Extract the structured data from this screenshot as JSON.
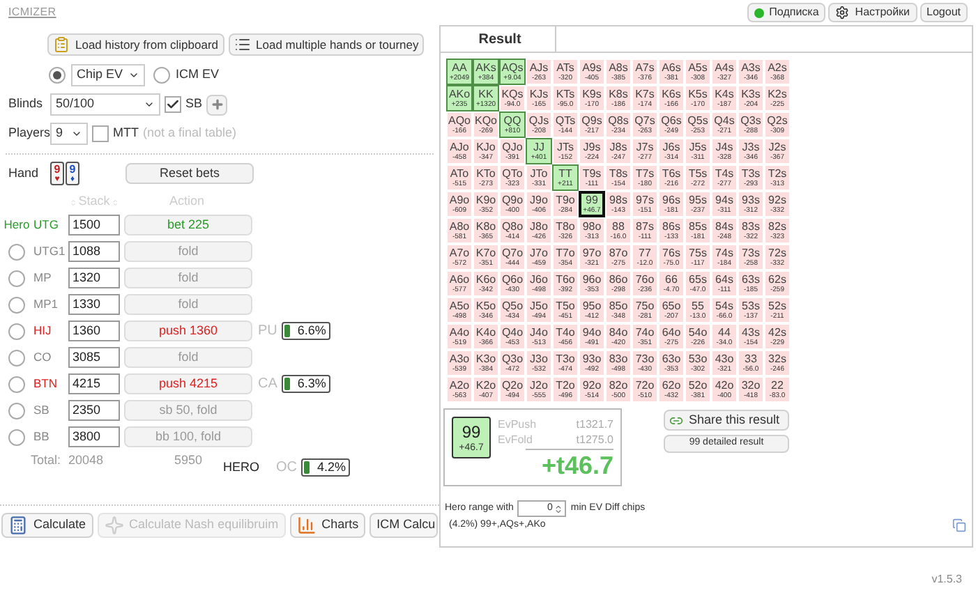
{
  "app": {
    "title": "ICMIZER",
    "version": "v1.5.3"
  },
  "top_buttons": [
    {
      "label": "Подписка",
      "kind": "dot"
    },
    {
      "label": "Настройки",
      "kind": "gear"
    },
    {
      "label": "Logout",
      "kind": "plain"
    }
  ],
  "load_buttons": [
    {
      "label": "Load history from clipboard",
      "kind": "clipboard"
    },
    {
      "label": "Load multiple hands or tourney",
      "kind": "list"
    }
  ],
  "ev_modes": [
    {
      "label": "Chip EV",
      "selected": true,
      "kind": "select"
    },
    {
      "label": "ICM EV",
      "selected": false,
      "kind": "plain"
    }
  ],
  "blinds": {
    "label": "Blinds",
    "value": "50/100",
    "sb_label": "SB",
    "sb_checked": true
  },
  "players_setting": {
    "label": "Players",
    "value": "9",
    "mtt_label": "MTT",
    "mtt_checked": false,
    "mtt_hint": "(not a final table)"
  },
  "hand": {
    "label": "Hand",
    "cards": [
      {
        "rank": "9",
        "suit": "♥",
        "color": "#c02020"
      },
      {
        "rank": "9",
        "suit": "♦",
        "color": "#2050c0"
      }
    ],
    "reset_label": "Reset bets"
  },
  "table_headers": {
    "stack": "Stack",
    "action": "Action"
  },
  "hero_label": "Hero",
  "players": [
    {
      "position": "UTG",
      "selected": true,
      "kind": "hero",
      "stack": "1500",
      "action": "bet 225"
    },
    {
      "position": "UTG1",
      "selected": false,
      "kind": "fold",
      "stack": "1088",
      "action": "fold"
    },
    {
      "position": "MP",
      "selected": false,
      "kind": "fold",
      "stack": "1320",
      "action": "fold"
    },
    {
      "position": "MP1",
      "selected": false,
      "kind": "fold",
      "stack": "1330",
      "action": "fold"
    },
    {
      "position": "HIJ",
      "selected": false,
      "kind": "push",
      "stack": "1360",
      "action": "push 1360",
      "range": {
        "tag": "PU",
        "percent": "6.6%"
      }
    },
    {
      "position": "CO",
      "selected": false,
      "kind": "fold",
      "stack": "3085",
      "action": "fold"
    },
    {
      "position": "BTN",
      "selected": false,
      "kind": "push",
      "stack": "4215",
      "action": "push 4215",
      "range": {
        "tag": "CA",
        "percent": "6.3%"
      }
    },
    {
      "position": "SB",
      "selected": false,
      "kind": "fold",
      "stack": "2350",
      "action": "sb 50, fold"
    },
    {
      "position": "BB",
      "selected": false,
      "kind": "fold",
      "stack": "3800",
      "action": "bb 100, fold"
    }
  ],
  "totals": {
    "label": "Total:",
    "stack": "20048",
    "pot": "5950"
  },
  "hero_range": {
    "label": "HERO",
    "tag": "OC",
    "percent": "4.2%"
  },
  "bottom_buttons": [
    {
      "label": "Calculate",
      "kind": "calculator",
      "disabled": false
    },
    {
      "label": "Calculate Nash equilibruim",
      "kind": "spark",
      "disabled": true
    },
    {
      "label": "Charts",
      "kind": "chart",
      "disabled": false
    },
    {
      "label": "ICM Calcu",
      "kind": "plain",
      "disabled": false
    }
  ],
  "result": {
    "tab": "Result",
    "grid": [
      [
        {
          "hand": "AA",
          "ev": "+2049",
          "in_range": true,
          "selected": false
        },
        {
          "hand": "AKs",
          "ev": "+384",
          "in_range": true,
          "selected": false
        },
        {
          "hand": "AQs",
          "ev": "+9.04",
          "in_range": true,
          "selected": false
        },
        {
          "hand": "AJs",
          "ev": "-263",
          "in_range": false,
          "selected": false
        },
        {
          "hand": "ATs",
          "ev": "-320",
          "in_range": false,
          "selected": false
        },
        {
          "hand": "A9s",
          "ev": "-405",
          "in_range": false,
          "selected": false
        },
        {
          "hand": "A8s",
          "ev": "-385",
          "in_range": false,
          "selected": false
        },
        {
          "hand": "A7s",
          "ev": "-376",
          "in_range": false,
          "selected": false
        },
        {
          "hand": "A6s",
          "ev": "-381",
          "in_range": false,
          "selected": false
        },
        {
          "hand": "A5s",
          "ev": "-308",
          "in_range": false,
          "selected": false
        },
        {
          "hand": "A4s",
          "ev": "-327",
          "in_range": false,
          "selected": false
        },
        {
          "hand": "A3s",
          "ev": "-346",
          "in_range": false,
          "selected": false
        },
        {
          "hand": "A2s",
          "ev": "-368",
          "in_range": false,
          "selected": false
        }
      ],
      [
        {
          "hand": "AKo",
          "ev": "+235",
          "in_range": true,
          "selected": false
        },
        {
          "hand": "KK",
          "ev": "+1320",
          "in_range": true,
          "selected": false
        },
        {
          "hand": "KQs",
          "ev": "-94.0",
          "in_range": false,
          "selected": false
        },
        {
          "hand": "KJs",
          "ev": "-165",
          "in_range": false,
          "selected": false
        },
        {
          "hand": "KTs",
          "ev": "-95.0",
          "in_range": false,
          "selected": false
        },
        {
          "hand": "K9s",
          "ev": "-170",
          "in_range": false,
          "selected": false
        },
        {
          "hand": "K8s",
          "ev": "-186",
          "in_range": false,
          "selected": false
        },
        {
          "hand": "K7s",
          "ev": "-174",
          "in_range": false,
          "selected": false
        },
        {
          "hand": "K6s",
          "ev": "-166",
          "in_range": false,
          "selected": false
        },
        {
          "hand": "K5s",
          "ev": "-170",
          "in_range": false,
          "selected": false
        },
        {
          "hand": "K4s",
          "ev": "-187",
          "in_range": false,
          "selected": false
        },
        {
          "hand": "K3s",
          "ev": "-204",
          "in_range": false,
          "selected": false
        },
        {
          "hand": "K2s",
          "ev": "-225",
          "in_range": false,
          "selected": false
        }
      ],
      [
        {
          "hand": "AQo",
          "ev": "-166",
          "in_range": false,
          "selected": false
        },
        {
          "hand": "KQo",
          "ev": "-269",
          "in_range": false,
          "selected": false
        },
        {
          "hand": "QQ",
          "ev": "+810",
          "in_range": true,
          "selected": false
        },
        {
          "hand": "QJs",
          "ev": "-208",
          "in_range": false,
          "selected": false
        },
        {
          "hand": "QTs",
          "ev": "-144",
          "in_range": false,
          "selected": false
        },
        {
          "hand": "Q9s",
          "ev": "-217",
          "in_range": false,
          "selected": false
        },
        {
          "hand": "Q8s",
          "ev": "-234",
          "in_range": false,
          "selected": false
        },
        {
          "hand": "Q7s",
          "ev": "-263",
          "in_range": false,
          "selected": false
        },
        {
          "hand": "Q6s",
          "ev": "-249",
          "in_range": false,
          "selected": false
        },
        {
          "hand": "Q5s",
          "ev": "-253",
          "in_range": false,
          "selected": false
        },
        {
          "hand": "Q4s",
          "ev": "-271",
          "in_range": false,
          "selected": false
        },
        {
          "hand": "Q3s",
          "ev": "-288",
          "in_range": false,
          "selected": false
        },
        {
          "hand": "Q2s",
          "ev": "-309",
          "in_range": false,
          "selected": false
        }
      ],
      [
        {
          "hand": "AJo",
          "ev": "-458",
          "in_range": false,
          "selected": false
        },
        {
          "hand": "KJo",
          "ev": "-347",
          "in_range": false,
          "selected": false
        },
        {
          "hand": "QJo",
          "ev": "-391",
          "in_range": false,
          "selected": false
        },
        {
          "hand": "JJ",
          "ev": "+401",
          "in_range": true,
          "selected": false
        },
        {
          "hand": "JTs",
          "ev": "-152",
          "in_range": false,
          "selected": false
        },
        {
          "hand": "J9s",
          "ev": "-224",
          "in_range": false,
          "selected": false
        },
        {
          "hand": "J8s",
          "ev": "-247",
          "in_range": false,
          "selected": false
        },
        {
          "hand": "J7s",
          "ev": "-277",
          "in_range": false,
          "selected": false
        },
        {
          "hand": "J6s",
          "ev": "-314",
          "in_range": false,
          "selected": false
        },
        {
          "hand": "J5s",
          "ev": "-311",
          "in_range": false,
          "selected": false
        },
        {
          "hand": "J4s",
          "ev": "-328",
          "in_range": false,
          "selected": false
        },
        {
          "hand": "J3s",
          "ev": "-346",
          "in_range": false,
          "selected": false
        },
        {
          "hand": "J2s",
          "ev": "-367",
          "in_range": false,
          "selected": false
        }
      ],
      [
        {
          "hand": "ATo",
          "ev": "-515",
          "in_range": false,
          "selected": false
        },
        {
          "hand": "KTo",
          "ev": "-273",
          "in_range": false,
          "selected": false
        },
        {
          "hand": "QTo",
          "ev": "-323",
          "in_range": false,
          "selected": false
        },
        {
          "hand": "JTo",
          "ev": "-331",
          "in_range": false,
          "selected": false
        },
        {
          "hand": "TT",
          "ev": "+211",
          "in_range": true,
          "selected": false
        },
        {
          "hand": "T9s",
          "ev": "-111",
          "in_range": false,
          "selected": false
        },
        {
          "hand": "T8s",
          "ev": "-154",
          "in_range": false,
          "selected": false
        },
        {
          "hand": "T7s",
          "ev": "-180",
          "in_range": false,
          "selected": false
        },
        {
          "hand": "T6s",
          "ev": "-216",
          "in_range": false,
          "selected": false
        },
        {
          "hand": "T5s",
          "ev": "-272",
          "in_range": false,
          "selected": false
        },
        {
          "hand": "T4s",
          "ev": "-277",
          "in_range": false,
          "selected": false
        },
        {
          "hand": "T3s",
          "ev": "-293",
          "in_range": false,
          "selected": false
        },
        {
          "hand": "T2s",
          "ev": "-313",
          "in_range": false,
          "selected": false
        }
      ],
      [
        {
          "hand": "A9o",
          "ev": "-609",
          "in_range": false,
          "selected": false
        },
        {
          "hand": "K9o",
          "ev": "-352",
          "in_range": false,
          "selected": false
        },
        {
          "hand": "Q9o",
          "ev": "-400",
          "in_range": false,
          "selected": false
        },
        {
          "hand": "J9o",
          "ev": "-406",
          "in_range": false,
          "selected": false
        },
        {
          "hand": "T9o",
          "ev": "-284",
          "in_range": false,
          "selected": false
        },
        {
          "hand": "99",
          "ev": "+46.7",
          "in_range": true,
          "selected": true
        },
        {
          "hand": "98s",
          "ev": "-143",
          "in_range": false,
          "selected": false
        },
        {
          "hand": "97s",
          "ev": "-151",
          "in_range": false,
          "selected": false
        },
        {
          "hand": "96s",
          "ev": "-181",
          "in_range": false,
          "selected": false
        },
        {
          "hand": "95s",
          "ev": "-237",
          "in_range": false,
          "selected": false
        },
        {
          "hand": "94s",
          "ev": "-311",
          "in_range": false,
          "selected": false
        },
        {
          "hand": "93s",
          "ev": "-312",
          "in_range": false,
          "selected": false
        },
        {
          "hand": "92s",
          "ev": "-332",
          "in_range": false,
          "selected": false
        }
      ],
      [
        {
          "hand": "A8o",
          "ev": "-581",
          "in_range": false,
          "selected": false
        },
        {
          "hand": "K8o",
          "ev": "-365",
          "in_range": false,
          "selected": false
        },
        {
          "hand": "Q8o",
          "ev": "-414",
          "in_range": false,
          "selected": false
        },
        {
          "hand": "J8o",
          "ev": "-426",
          "in_range": false,
          "selected": false
        },
        {
          "hand": "T8o",
          "ev": "-326",
          "in_range": false,
          "selected": false
        },
        {
          "hand": "98o",
          "ev": "-313",
          "in_range": false,
          "selected": false
        },
        {
          "hand": "88",
          "ev": "-16.0",
          "in_range": false,
          "selected": false
        },
        {
          "hand": "87s",
          "ev": "-111",
          "in_range": false,
          "selected": false
        },
        {
          "hand": "86s",
          "ev": "-133",
          "in_range": false,
          "selected": false
        },
        {
          "hand": "85s",
          "ev": "-181",
          "in_range": false,
          "selected": false
        },
        {
          "hand": "84s",
          "ev": "-248",
          "in_range": false,
          "selected": false
        },
        {
          "hand": "83s",
          "ev": "-322",
          "in_range": false,
          "selected": false
        },
        {
          "hand": "82s",
          "ev": "-323",
          "in_range": false,
          "selected": false
        }
      ],
      [
        {
          "hand": "A7o",
          "ev": "-572",
          "in_range": false,
          "selected": false
        },
        {
          "hand": "K7o",
          "ev": "-351",
          "in_range": false,
          "selected": false
        },
        {
          "hand": "Q7o",
          "ev": "-444",
          "in_range": false,
          "selected": false
        },
        {
          "hand": "J7o",
          "ev": "-459",
          "in_range": false,
          "selected": false
        },
        {
          "hand": "T7o",
          "ev": "-354",
          "in_range": false,
          "selected": false
        },
        {
          "hand": "97o",
          "ev": "-321",
          "in_range": false,
          "selected": false
        },
        {
          "hand": "87o",
          "ev": "-275",
          "in_range": false,
          "selected": false
        },
        {
          "hand": "77",
          "ev": "-12.0",
          "in_range": false,
          "selected": false
        },
        {
          "hand": "76s",
          "ev": "-75.0",
          "in_range": false,
          "selected": false
        },
        {
          "hand": "75s",
          "ev": "-117",
          "in_range": false,
          "selected": false
        },
        {
          "hand": "74s",
          "ev": "-184",
          "in_range": false,
          "selected": false
        },
        {
          "hand": "73s",
          "ev": "-258",
          "in_range": false,
          "selected": false
        },
        {
          "hand": "72s",
          "ev": "-332",
          "in_range": false,
          "selected": false
        }
      ],
      [
        {
          "hand": "A6o",
          "ev": "-577",
          "in_range": false,
          "selected": false
        },
        {
          "hand": "K6o",
          "ev": "-342",
          "in_range": false,
          "selected": false
        },
        {
          "hand": "Q6o",
          "ev": "-430",
          "in_range": false,
          "selected": false
        },
        {
          "hand": "J6o",
          "ev": "-498",
          "in_range": false,
          "selected": false
        },
        {
          "hand": "T6o",
          "ev": "-392",
          "in_range": false,
          "selected": false
        },
        {
          "hand": "96o",
          "ev": "-353",
          "in_range": false,
          "selected": false
        },
        {
          "hand": "86o",
          "ev": "-298",
          "in_range": false,
          "selected": false
        },
        {
          "hand": "76o",
          "ev": "-236",
          "in_range": false,
          "selected": false
        },
        {
          "hand": "66",
          "ev": "-4.70",
          "in_range": false,
          "selected": false
        },
        {
          "hand": "65s",
          "ev": "-47.0",
          "in_range": false,
          "selected": false
        },
        {
          "hand": "64s",
          "ev": "-111",
          "in_range": false,
          "selected": false
        },
        {
          "hand": "63s",
          "ev": "-185",
          "in_range": false,
          "selected": false
        },
        {
          "hand": "62s",
          "ev": "-259",
          "in_range": false,
          "selected": false
        }
      ],
      [
        {
          "hand": "A5o",
          "ev": "-498",
          "in_range": false,
          "selected": false
        },
        {
          "hand": "K5o",
          "ev": "-346",
          "in_range": false,
          "selected": false
        },
        {
          "hand": "Q5o",
          "ev": "-434",
          "in_range": false,
          "selected": false
        },
        {
          "hand": "J5o",
          "ev": "-494",
          "in_range": false,
          "selected": false
        },
        {
          "hand": "T5o",
          "ev": "-451",
          "in_range": false,
          "selected": false
        },
        {
          "hand": "95o",
          "ev": "-412",
          "in_range": false,
          "selected": false
        },
        {
          "hand": "85o",
          "ev": "-348",
          "in_range": false,
          "selected": false
        },
        {
          "hand": "75o",
          "ev": "-281",
          "in_range": false,
          "selected": false
        },
        {
          "hand": "65o",
          "ev": "-207",
          "in_range": false,
          "selected": false
        },
        {
          "hand": "55",
          "ev": "-13.0",
          "in_range": false,
          "selected": false
        },
        {
          "hand": "54s",
          "ev": "-66.0",
          "in_range": false,
          "selected": false
        },
        {
          "hand": "53s",
          "ev": "-137",
          "in_range": false,
          "selected": false
        },
        {
          "hand": "52s",
          "ev": "-211",
          "in_range": false,
          "selected": false
        }
      ],
      [
        {
          "hand": "A4o",
          "ev": "-519",
          "in_range": false,
          "selected": false
        },
        {
          "hand": "K4o",
          "ev": "-366",
          "in_range": false,
          "selected": false
        },
        {
          "hand": "Q4o",
          "ev": "-453",
          "in_range": false,
          "selected": false
        },
        {
          "hand": "J4o",
          "ev": "-513",
          "in_range": false,
          "selected": false
        },
        {
          "hand": "T4o",
          "ev": "-456",
          "in_range": false,
          "selected": false
        },
        {
          "hand": "94o",
          "ev": "-491",
          "in_range": false,
          "selected": false
        },
        {
          "hand": "84o",
          "ev": "-420",
          "in_range": false,
          "selected": false
        },
        {
          "hand": "74o",
          "ev": "-351",
          "in_range": false,
          "selected": false
        },
        {
          "hand": "64o",
          "ev": "-275",
          "in_range": false,
          "selected": false
        },
        {
          "hand": "54o",
          "ev": "-226",
          "in_range": false,
          "selected": false
        },
        {
          "hand": "44",
          "ev": "-34.0",
          "in_range": false,
          "selected": false
        },
        {
          "hand": "43s",
          "ev": "-154",
          "in_range": false,
          "selected": false
        },
        {
          "hand": "42s",
          "ev": "-229",
          "in_range": false,
          "selected": false
        }
      ],
      [
        {
          "hand": "A3o",
          "ev": "-539",
          "in_range": false,
          "selected": false
        },
        {
          "hand": "K3o",
          "ev": "-384",
          "in_range": false,
          "selected": false
        },
        {
          "hand": "Q3o",
          "ev": "-472",
          "in_range": false,
          "selected": false
        },
        {
          "hand": "J3o",
          "ev": "-532",
          "in_range": false,
          "selected": false
        },
        {
          "hand": "T3o",
          "ev": "-474",
          "in_range": false,
          "selected": false
        },
        {
          "hand": "93o",
          "ev": "-492",
          "in_range": false,
          "selected": false
        },
        {
          "hand": "83o",
          "ev": "-498",
          "in_range": false,
          "selected": false
        },
        {
          "hand": "73o",
          "ev": "-430",
          "in_range": false,
          "selected": false
        },
        {
          "hand": "63o",
          "ev": "-353",
          "in_range": false,
          "selected": false
        },
        {
          "hand": "53o",
          "ev": "-302",
          "in_range": false,
          "selected": false
        },
        {
          "hand": "43o",
          "ev": "-321",
          "in_range": false,
          "selected": false
        },
        {
          "hand": "33",
          "ev": "-56.0",
          "in_range": false,
          "selected": false
        },
        {
          "hand": "32s",
          "ev": "-246",
          "in_range": false,
          "selected": false
        }
      ],
      [
        {
          "hand": "A2o",
          "ev": "-563",
          "in_range": false,
          "selected": false
        },
        {
          "hand": "K2o",
          "ev": "-407",
          "in_range": false,
          "selected": false
        },
        {
          "hand": "Q2o",
          "ev": "-494",
          "in_range": false,
          "selected": false
        },
        {
          "hand": "J2o",
          "ev": "-555",
          "in_range": false,
          "selected": false
        },
        {
          "hand": "T2o",
          "ev": "-496",
          "in_range": false,
          "selected": false
        },
        {
          "hand": "92o",
          "ev": "-514",
          "in_range": false,
          "selected": false
        },
        {
          "hand": "82o",
          "ev": "-500",
          "in_range": false,
          "selected": false
        },
        {
          "hand": "72o",
          "ev": "-510",
          "in_range": false,
          "selected": false
        },
        {
          "hand": "62o",
          "ev": "-432",
          "in_range": false,
          "selected": false
        },
        {
          "hand": "52o",
          "ev": "-381",
          "in_range": false,
          "selected": false
        },
        {
          "hand": "42o",
          "ev": "-400",
          "in_range": false,
          "selected": false
        },
        {
          "hand": "32o",
          "ev": "-418",
          "in_range": false,
          "selected": false
        },
        {
          "hand": "22",
          "ev": "-83.0",
          "in_range": false,
          "selected": false
        }
      ]
    ],
    "detail": {
      "hand": "99",
      "ev": "+46.7",
      "rows": [
        {
          "label": "EvPush",
          "value": "t1321.7"
        },
        {
          "label": "EvFold",
          "value": "t1275.0"
        }
      ],
      "total": "+t46.7"
    },
    "share_label": "Share this result",
    "detailed_label": "99 detailed result",
    "range_filter": {
      "label": "Hero range with",
      "value": "0",
      "suffix": "min EV Diff chips"
    },
    "range_text": "(4.2%) 99+,AQs+,AKo"
  }
}
